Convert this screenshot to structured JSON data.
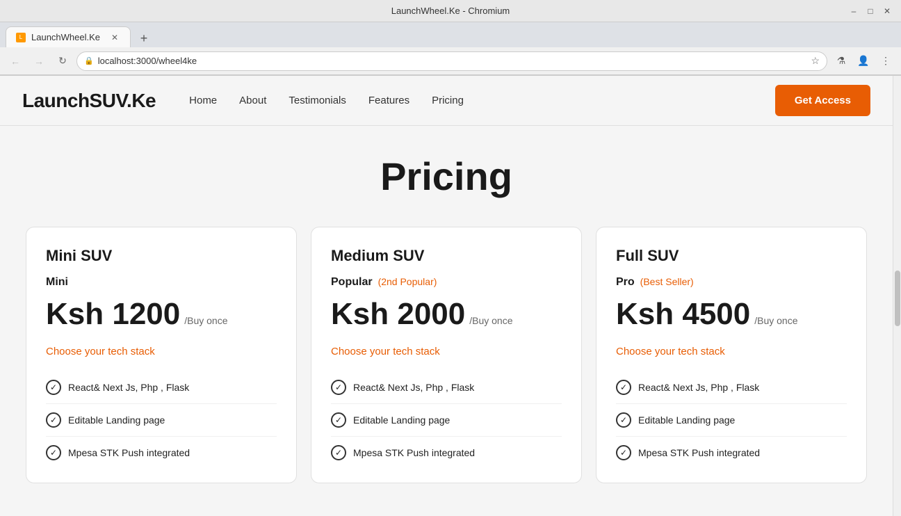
{
  "browser": {
    "title": "LaunchWheel.Ke - Chromium",
    "tab_label": "LaunchWheel.Ke",
    "url": "localhost:3000/wheel4ke",
    "new_tab_symbol": "+",
    "back_btn": "←",
    "forward_btn": "→",
    "reload_btn": "↻"
  },
  "site": {
    "logo": "LaunchSUV.Ke",
    "nav_links": [
      {
        "label": "Home",
        "key": "home"
      },
      {
        "label": "About",
        "key": "about"
      },
      {
        "label": "Testimonials",
        "key": "testimonials"
      },
      {
        "label": "Features",
        "key": "features"
      },
      {
        "label": "Pricing",
        "key": "pricing"
      }
    ],
    "cta_label": "Get Access"
  },
  "pricing": {
    "title": "Pricing",
    "cards": [
      {
        "tier": "Mini SUV",
        "plan_name": "Mini",
        "plan_badge": "",
        "price": "Ksh 1200",
        "period": "/Buy once",
        "tech_link": "Choose your tech stack",
        "features": [
          "React& Next Js, Php , Flask",
          "Editable Landing page",
          "Mpesa STK Push integrated"
        ]
      },
      {
        "tier": "Medium SUV",
        "plan_name": "Popular",
        "plan_badge": "(2nd Popular)",
        "price": "Ksh 2000",
        "period": "/Buy once",
        "tech_link": "Choose your tech stack",
        "features": [
          "React& Next Js, Php , Flask",
          "Editable Landing page",
          "Mpesa STK Push integrated"
        ]
      },
      {
        "tier": "Full SUV",
        "plan_name": "Pro",
        "plan_badge": "(Best Seller)",
        "price": "Ksh 4500",
        "period": "/Buy once",
        "tech_link": "Choose your tech stack",
        "features": [
          "React& Next Js, Php , Flask",
          "Editable Landing page",
          "Mpesa STK Push integrated"
        ]
      }
    ]
  }
}
